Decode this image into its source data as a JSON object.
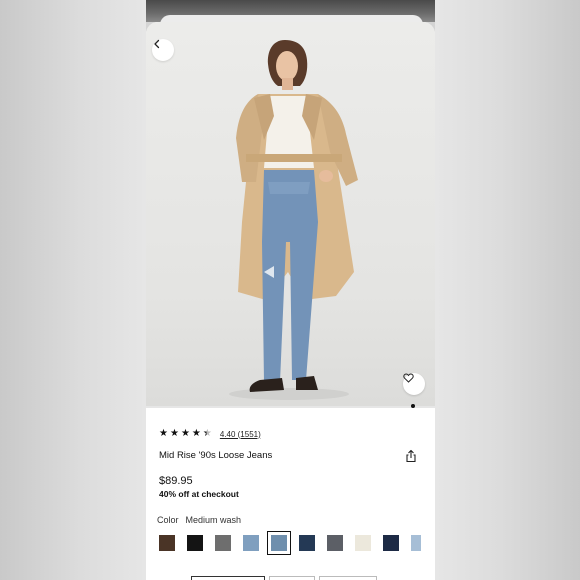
{
  "product": {
    "name": "Mid Rise '90s Loose Jeans",
    "price": "$89.95",
    "promo": "40% off at checkout",
    "rating_text": "4.40 (1551)",
    "rating": 4.4
  },
  "color": {
    "label": "Color",
    "selected": "Medium wash",
    "swatches": [
      "#4a3426",
      "#141414",
      "#6e6e6e",
      "#7f9fbf",
      "#6f8fad",
      "#243955",
      "#5c5f66",
      "#ece8dc",
      "#1d2a45",
      "#a6bed6"
    ]
  },
  "carousel": {
    "current_slide": 1
  }
}
